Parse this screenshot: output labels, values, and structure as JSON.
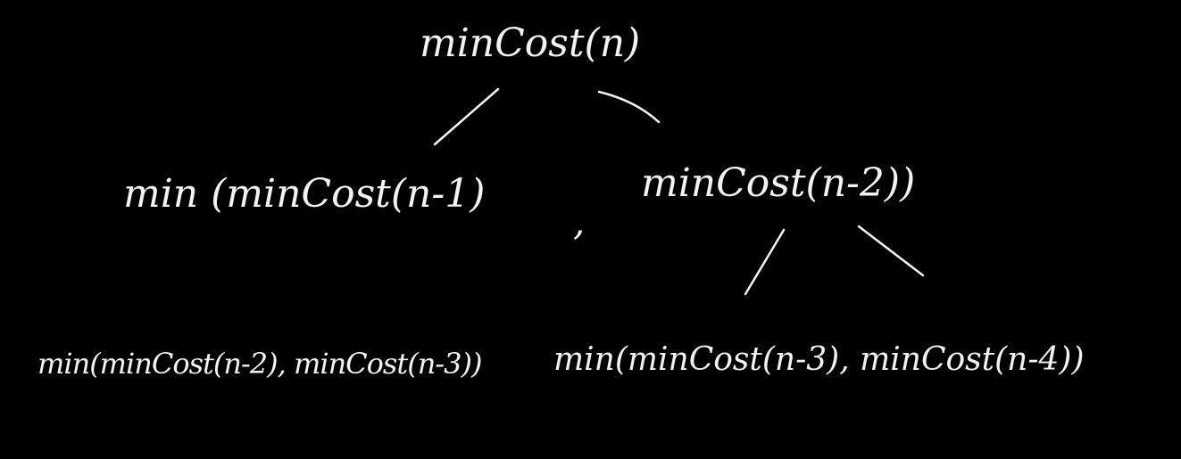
{
  "tree": {
    "root": "minCost(n)",
    "level1": {
      "left_part": "min (minCost(n-1)",
      "separator": ",",
      "right_part": "minCost(n-2))"
    },
    "level2": {
      "left": "min(minCost(n-2), minCost(n-3))",
      "right": "min(minCost(n-3), minCost(n-4))"
    }
  },
  "colors": {
    "background": "#000000",
    "ink": "#f2f2f2"
  }
}
